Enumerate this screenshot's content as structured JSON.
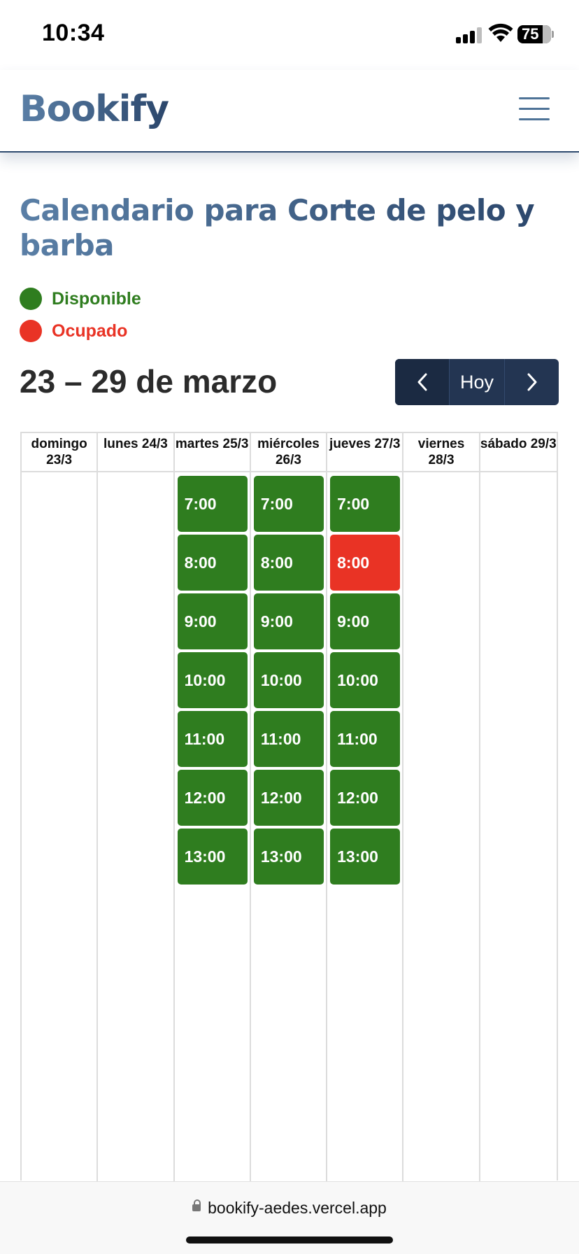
{
  "status_bar": {
    "time": "10:34",
    "battery_level": "75",
    "signal_bars": 3,
    "icons": [
      "signal-icon",
      "wifi-icon",
      "battery-icon"
    ]
  },
  "header": {
    "brand": "Bookify",
    "menu_icon": "hamburger-menu-icon"
  },
  "page": {
    "title": "Calendario para Corte de pelo y barba"
  },
  "legend": [
    {
      "label": "Disponible",
      "color": "#2f7d1f"
    },
    {
      "label": "Ocupado",
      "color": "#e93325"
    }
  ],
  "calendar_nav": {
    "range": "23 – 29 de marzo",
    "prev_icon": "chevron-left-icon",
    "today_label": "Hoy",
    "next_icon": "chevron-right-icon"
  },
  "calendar": {
    "days": [
      {
        "name": "domingo",
        "date": "23/3",
        "slots": []
      },
      {
        "name": "lunes",
        "date": "24/3",
        "slots": []
      },
      {
        "name": "martes",
        "date": "25/3",
        "slots": [
          {
            "time": "7:00",
            "status": "available"
          },
          {
            "time": "8:00",
            "status": "available"
          },
          {
            "time": "9:00",
            "status": "available"
          },
          {
            "time": "10:00",
            "status": "available"
          },
          {
            "time": "11:00",
            "status": "available"
          },
          {
            "time": "12:00",
            "status": "available"
          },
          {
            "time": "13:00",
            "status": "available"
          }
        ]
      },
      {
        "name": "miércoles",
        "date": "26/3",
        "slots": [
          {
            "time": "7:00",
            "status": "available"
          },
          {
            "time": "8:00",
            "status": "available"
          },
          {
            "time": "9:00",
            "status": "available"
          },
          {
            "time": "10:00",
            "status": "available"
          },
          {
            "time": "11:00",
            "status": "available"
          },
          {
            "time": "12:00",
            "status": "available"
          },
          {
            "time": "13:00",
            "status": "available"
          }
        ]
      },
      {
        "name": "jueves",
        "date": "27/3",
        "slots": [
          {
            "time": "7:00",
            "status": "available"
          },
          {
            "time": "8:00",
            "status": "busy"
          },
          {
            "time": "9:00",
            "status": "available"
          },
          {
            "time": "10:00",
            "status": "available"
          },
          {
            "time": "11:00",
            "status": "available"
          },
          {
            "time": "12:00",
            "status": "available"
          },
          {
            "time": "13:00",
            "status": "available"
          }
        ]
      },
      {
        "name": "viernes",
        "date": "28/3",
        "slots": []
      },
      {
        "name": "sábado",
        "date": "29/3",
        "slots": []
      }
    ],
    "status_colors": {
      "available": "#2f7d1f",
      "busy": "#e93325"
    }
  },
  "browser": {
    "url": "bookify-aedes.vercel.app",
    "lock_icon": "lock-icon"
  }
}
